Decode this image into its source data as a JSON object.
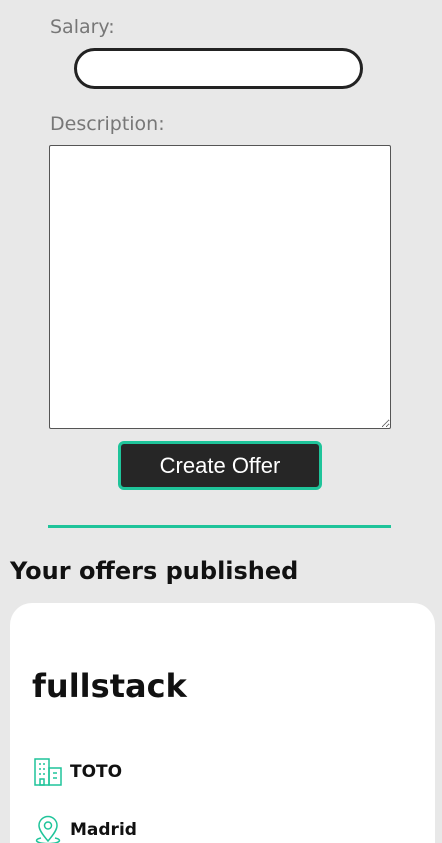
{
  "form": {
    "salary_label": "Salary:",
    "salary_value": "",
    "description_label": "Description:",
    "description_value": "",
    "submit_label": "Create Offer"
  },
  "published": {
    "section_title": "Your offers published",
    "offers": [
      {
        "title": "fullstack",
        "company": "TOTO",
        "location": "Madrid",
        "company_icon": "building-icon",
        "location_icon": "map-pin-icon"
      }
    ]
  },
  "colors": {
    "accent": "#1fc49a",
    "button_bg": "#262626",
    "page_bg": "#e8e8e8"
  }
}
